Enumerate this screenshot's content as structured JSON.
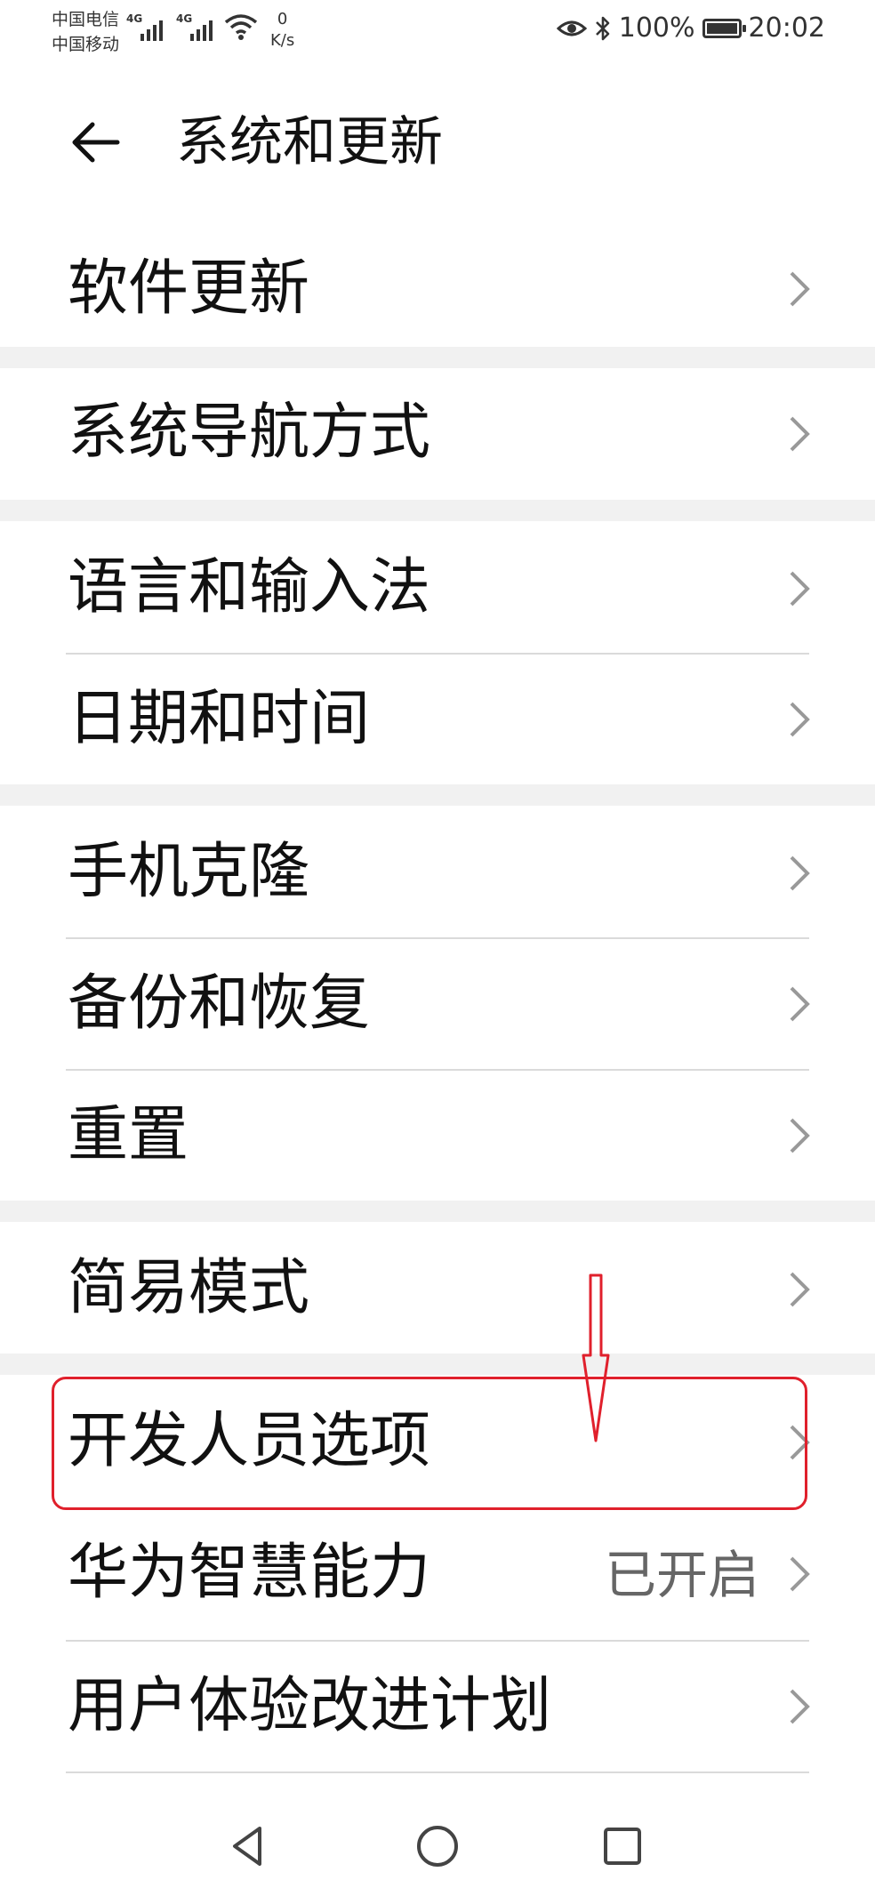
{
  "status_bar": {
    "carrier_1": "中国电信",
    "carrier_2": "中国移动",
    "signal_1_type": "4G",
    "signal_2_type": "4G",
    "speed_value": "0",
    "speed_unit": "K/s",
    "battery": "100%",
    "time": "20:02"
  },
  "header": {
    "title": "系统和更新",
    "back_icon": "arrow-left-icon"
  },
  "menu": {
    "software_update": "软件更新",
    "system_navigation": "系统导航方式",
    "language_input": "语言和输入法",
    "date_time": "日期和时间",
    "phone_clone": "手机克隆",
    "backup_restore": "备份和恢复",
    "reset": "重置",
    "simple_mode": "简易模式",
    "developer_options": "开发人员选项",
    "huawei_ai": "华为智慧能力",
    "huawei_ai_value": "已开启",
    "user_experience": "用户体验改进计划"
  },
  "annotation": {
    "highlight_color": "#e0202c"
  },
  "nav_icons": [
    "back-triangle-icon",
    "home-circle-icon",
    "recents-square-icon"
  ]
}
